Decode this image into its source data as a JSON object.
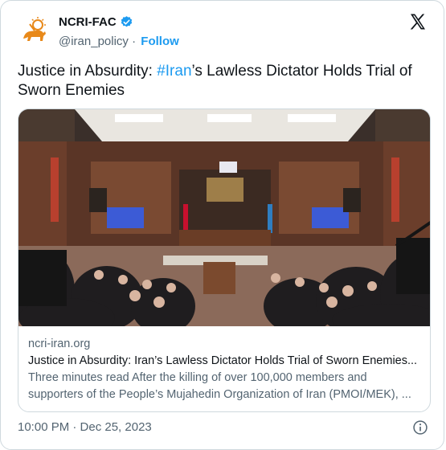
{
  "account": {
    "name": "NCRI-FAC",
    "handle": "@iran_policy",
    "separator": "·",
    "follow_label": "Follow"
  },
  "tweet": {
    "text_before": "Justice in Absurdity: ",
    "hashtag": "#Iran",
    "text_after": "’s Lawless Dictator Holds Trial of Sworn Enemies",
    "timestamp": "10:00 PM · Dec 25, 2023"
  },
  "card": {
    "domain": "ncri-iran.org",
    "title": "Justice in Absurdity: Iran’s Lawless Dictator Holds Trial of Sworn Enemies...",
    "description": "Three minutes read After the killing of over 100,000 members and supporters of the People’s Mujahedin Organization of Iran (PMOI/MEK), ..."
  },
  "icons": {
    "verified": "verified-badge-icon",
    "platform": "x-logo-icon",
    "info": "info-icon"
  },
  "colors": {
    "link": "#1d9bf0",
    "secondary_text": "#536471",
    "border": "#cfd9de",
    "logo_orange": "#e8891a"
  }
}
